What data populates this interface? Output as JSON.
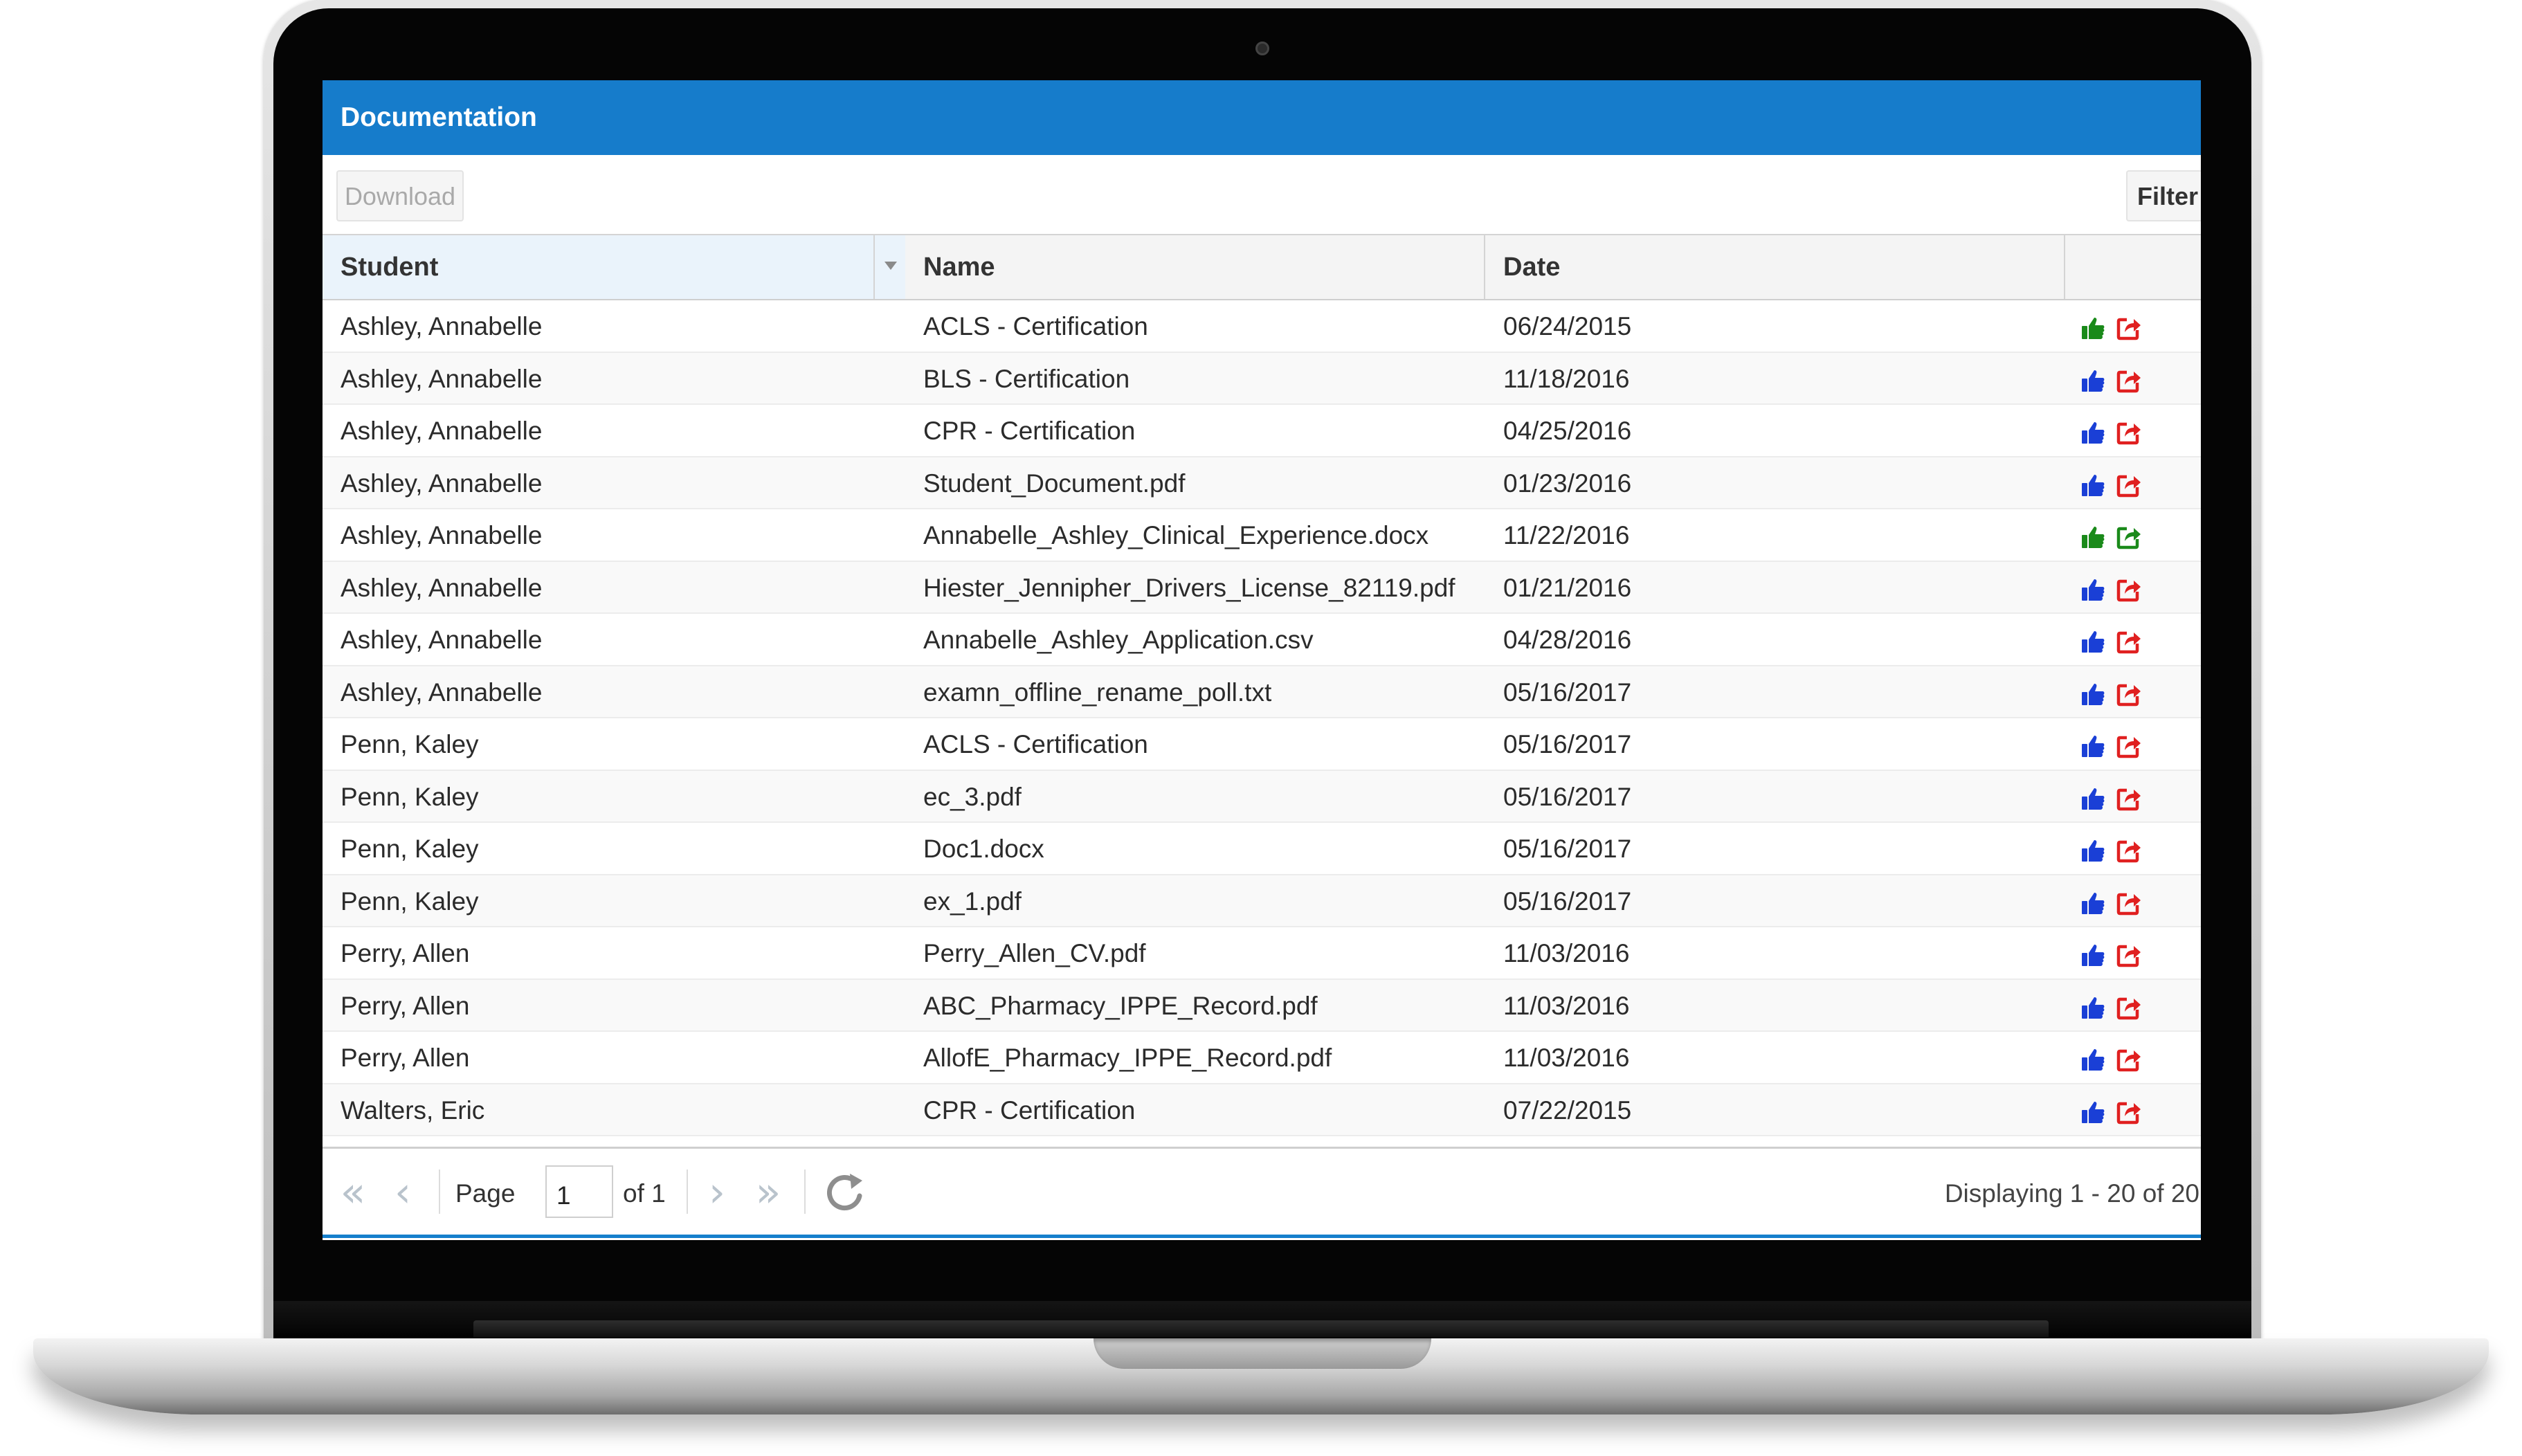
{
  "panel": {
    "title": "Documentation"
  },
  "toolbar": {
    "download_label": "Download",
    "filter_label": "Filter"
  },
  "grid": {
    "columns": [
      {
        "key": "student",
        "label": "Student"
      },
      {
        "key": "name",
        "label": "Name"
      },
      {
        "key": "date",
        "label": "Date"
      },
      {
        "key": "actions",
        "label": ""
      }
    ],
    "rows": [
      {
        "student": "Ashley, Annabelle",
        "name": "ACLS - Certification",
        "date": "06/24/2015",
        "thumb_color": "#1a8a1a",
        "share_color": "#e02020"
      },
      {
        "student": "Ashley, Annabelle",
        "name": "BLS - Certification",
        "date": "11/18/2016",
        "thumb_color": "#1a3fd6",
        "share_color": "#e02020"
      },
      {
        "student": "Ashley, Annabelle",
        "name": "CPR - Certification",
        "date": "04/25/2016",
        "thumb_color": "#1a3fd6",
        "share_color": "#e02020"
      },
      {
        "student": "Ashley, Annabelle",
        "name": "Student_Document.pdf",
        "date": "01/23/2016",
        "thumb_color": "#1a3fd6",
        "share_color": "#e02020"
      },
      {
        "student": "Ashley, Annabelle",
        "name": "Annabelle_Ashley_Clinical_Experience.docx",
        "date": "11/22/2016",
        "thumb_color": "#1a8a1a",
        "share_color": "#1a8a1a"
      },
      {
        "student": "Ashley, Annabelle",
        "name": "Hiester_Jennipher_Drivers_License_82119.pdf",
        "date": "01/21/2016",
        "thumb_color": "#1a3fd6",
        "share_color": "#e02020"
      },
      {
        "student": "Ashley, Annabelle",
        "name": "Annabelle_Ashley_Application.csv",
        "date": "04/28/2016",
        "thumb_color": "#1a3fd6",
        "share_color": "#e02020"
      },
      {
        "student": "Ashley, Annabelle",
        "name": "examn_offline_rename_poll.txt",
        "date": "05/16/2017",
        "thumb_color": "#1a3fd6",
        "share_color": "#e02020"
      },
      {
        "student": "Penn, Kaley",
        "name": "ACLS - Certification",
        "date": "05/16/2017",
        "thumb_color": "#1a3fd6",
        "share_color": "#e02020"
      },
      {
        "student": "Penn, Kaley",
        "name": "ec_3.pdf",
        "date": "05/16/2017",
        "thumb_color": "#1a3fd6",
        "share_color": "#e02020"
      },
      {
        "student": "Penn, Kaley",
        "name": "Doc1.docx",
        "date": "05/16/2017",
        "thumb_color": "#1a3fd6",
        "share_color": "#e02020"
      },
      {
        "student": "Penn, Kaley",
        "name": "ex_1.pdf",
        "date": "05/16/2017",
        "thumb_color": "#1a3fd6",
        "share_color": "#e02020"
      },
      {
        "student": "Perry, Allen",
        "name": "Perry_Allen_CV.pdf",
        "date": "11/03/2016",
        "thumb_color": "#1a3fd6",
        "share_color": "#e02020"
      },
      {
        "student": "Perry, Allen",
        "name": "ABC_Pharmacy_IPPE_Record.pdf",
        "date": "11/03/2016",
        "thumb_color": "#1a3fd6",
        "share_color": "#e02020"
      },
      {
        "student": "Perry, Allen",
        "name": "AllofE_Pharmacy_IPPE_Record.pdf",
        "date": "11/03/2016",
        "thumb_color": "#1a3fd6",
        "share_color": "#e02020"
      },
      {
        "student": "Walters, Eric",
        "name": "CPR - Certification",
        "date": "07/22/2015",
        "thumb_color": "#1a3fd6",
        "share_color": "#e02020"
      }
    ]
  },
  "paging": {
    "page_label": "Page",
    "current_page": "1",
    "of_label": "of 1",
    "display_text": "Displaying 1 - 20 of 20"
  },
  "colors": {
    "header_blue": "#167ccb",
    "approve_green": "#1a8a1a",
    "approve_blue": "#1a3fd6",
    "share_red": "#e02020"
  }
}
